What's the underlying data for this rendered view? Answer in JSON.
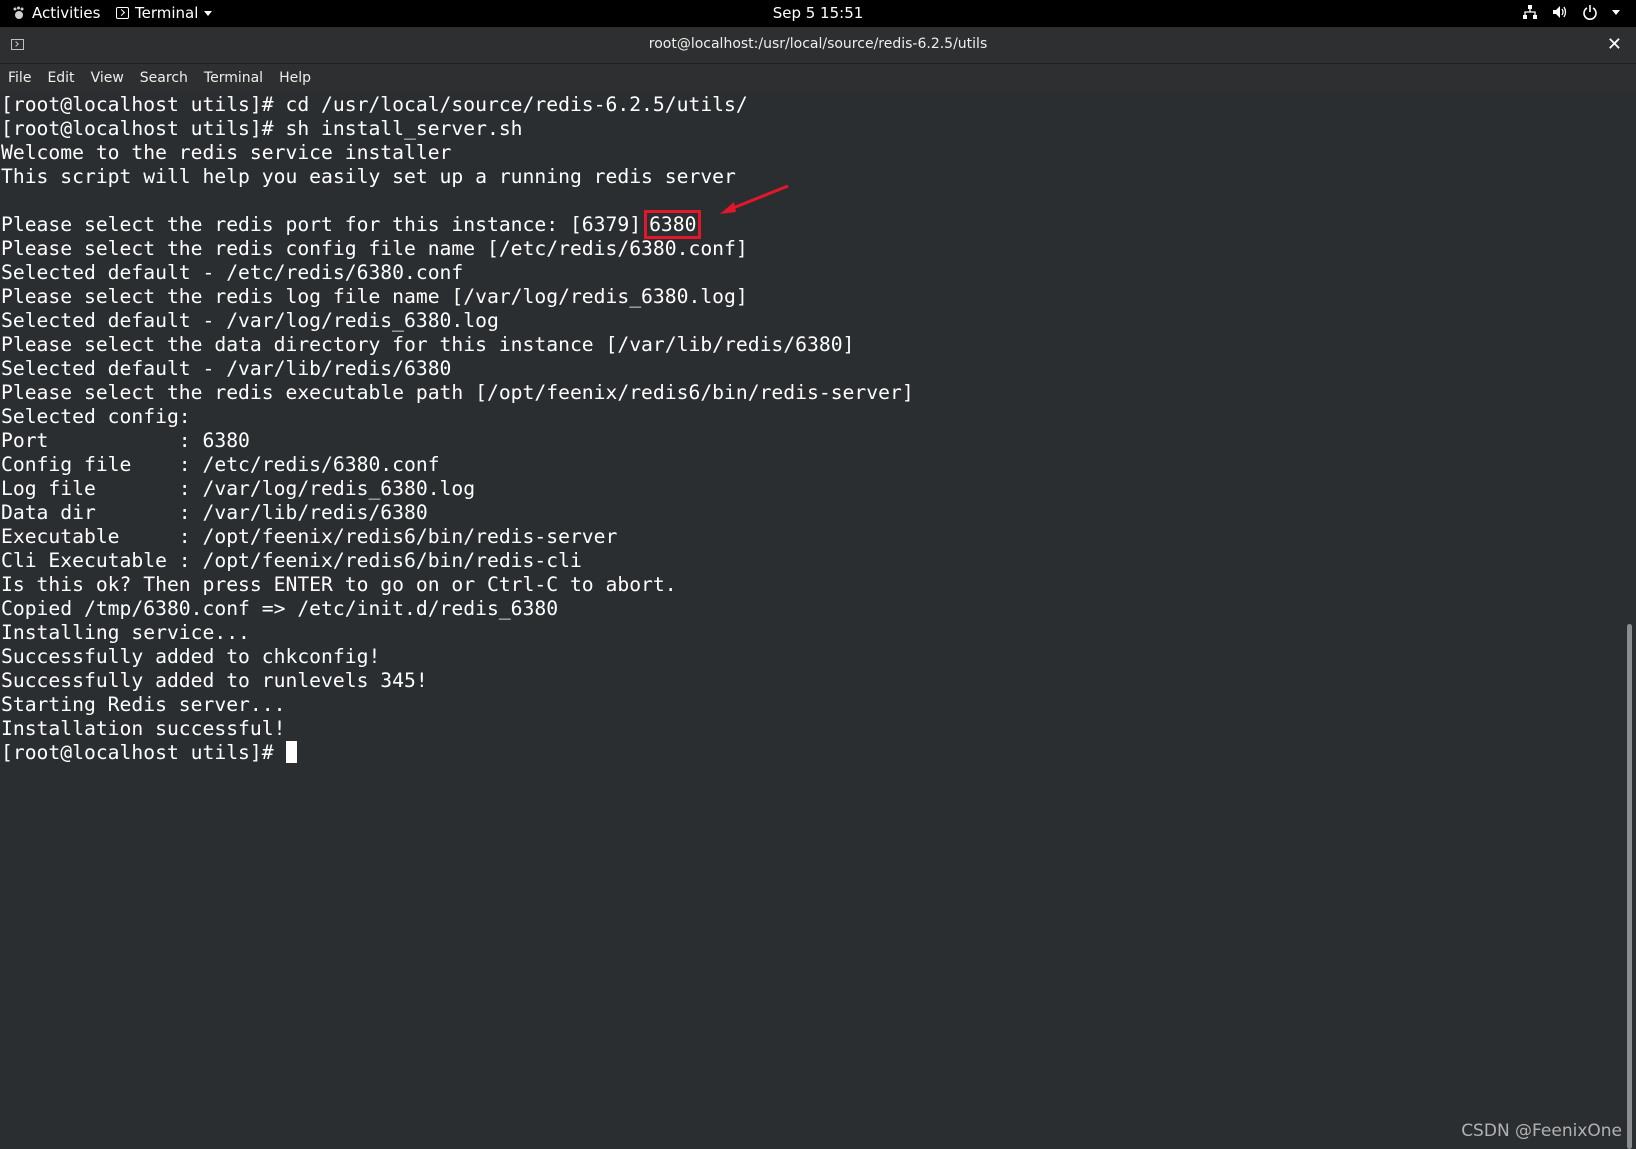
{
  "topbar": {
    "activities_label": "Activities",
    "app_label": "Terminal",
    "clock": "Sep 5  15:51",
    "status_icons": [
      "network-icon",
      "volume-icon",
      "power-icon"
    ]
  },
  "window": {
    "title": "root@localhost:/usr/local/source/redis-6.2.5/utils",
    "close_glyph": "✕"
  },
  "menubar": {
    "items": [
      "File",
      "Edit",
      "View",
      "Search",
      "Terminal",
      "Help"
    ]
  },
  "terminal": {
    "line_before_port": "Please select the redis port for this instance: [6379]",
    "port_input": "6380",
    "lines_top": [
      "[root@localhost utils]# cd /usr/local/source/redis-6.2.5/utils/",
      "[root@localhost utils]# sh install_server.sh",
      "Welcome to the redis service installer",
      "This script will help you easily set up a running redis server",
      ""
    ],
    "lines_bottom": [
      "Please select the redis config file name [/etc/redis/6380.conf]",
      "Selected default - /etc/redis/6380.conf",
      "Please select the redis log file name [/var/log/redis_6380.log]",
      "Selected default - /var/log/redis_6380.log",
      "Please select the data directory for this instance [/var/lib/redis/6380]",
      "Selected default - /var/lib/redis/6380",
      "Please select the redis executable path [/opt/feenix/redis6/bin/redis-server]",
      "Selected config:",
      "Port           : 6380",
      "Config file    : /etc/redis/6380.conf",
      "Log file       : /var/log/redis_6380.log",
      "Data dir       : /var/lib/redis/6380",
      "Executable     : /opt/feenix/redis6/bin/redis-server",
      "Cli Executable : /opt/feenix/redis6/bin/redis-cli",
      "Is this ok? Then press ENTER to go on or Ctrl-C to abort.",
      "Copied /tmp/6380.conf => /etc/init.d/redis_6380",
      "Installing service...",
      "Successfully added to chkconfig!",
      "Successfully added to runlevels 345!",
      "Starting Redis server...",
      "Installation successful!"
    ],
    "prompt": "[root@localhost utils]#"
  },
  "colors": {
    "highlight_box": "#e3162a",
    "terminal_bg": "#2b2e31",
    "terminal_fg": "#ffffff"
  },
  "watermark": "CSDN @FeenixOne"
}
